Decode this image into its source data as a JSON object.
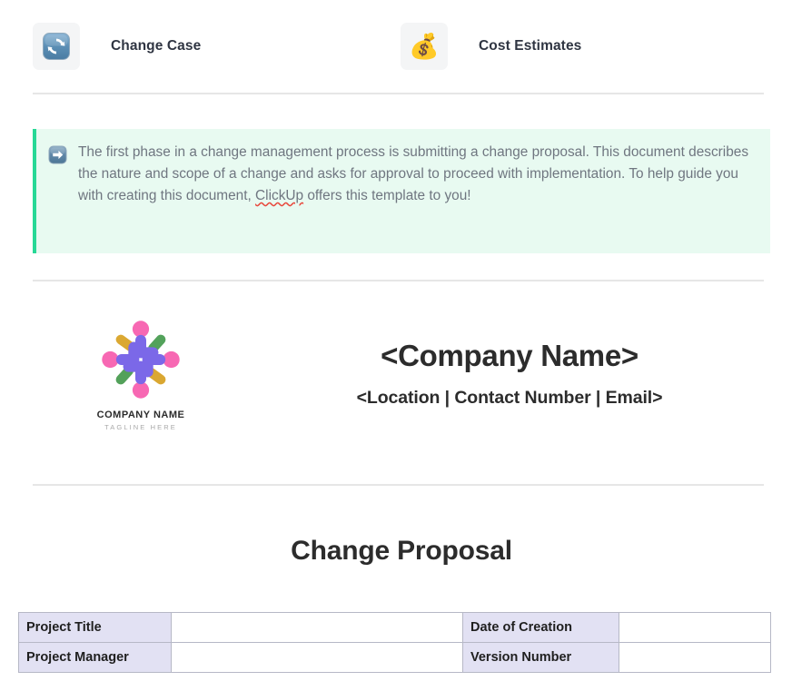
{
  "page_links": [
    {
      "icon": "sync-icon",
      "label": "Change Case"
    },
    {
      "icon": "money-bag-icon",
      "label": "Cost Estimates",
      "glyph": "💰"
    }
  ],
  "callout": {
    "icon": "arrow-right-icon",
    "text_part_1": "The first phase in a change management process is submitting a change proposal. This document describes the nature and scope of a change and asks for approval to proceed with implementation. To help guide you with creating this document, ",
    "misspelled_word": "ClickUp",
    "text_part_2": " offers this template to you!",
    "accent_color": "#27d896",
    "background_color": "#e8faf1"
  },
  "letterhead": {
    "logo": {
      "name": "COMPANY NAME",
      "tagline": "TAGLINE HERE",
      "colors": {
        "purple": "#7b68e8",
        "pink": "#f768b3",
        "gold": "#d9a327",
        "green": "#4a9d52"
      }
    },
    "company_name": "<Company Name>",
    "company_contact": "<Location | Contact Number | Email>"
  },
  "document": {
    "title": "Change Proposal"
  },
  "info_table": {
    "rows": [
      {
        "label_left": "Project Title",
        "value_left": "",
        "label_right": "Date of Creation",
        "value_right": ""
      },
      {
        "label_left": "Project Manager",
        "value_left": "",
        "label_right": "Version Number",
        "value_right": ""
      }
    ],
    "header_fill": "#e2e1f3"
  }
}
